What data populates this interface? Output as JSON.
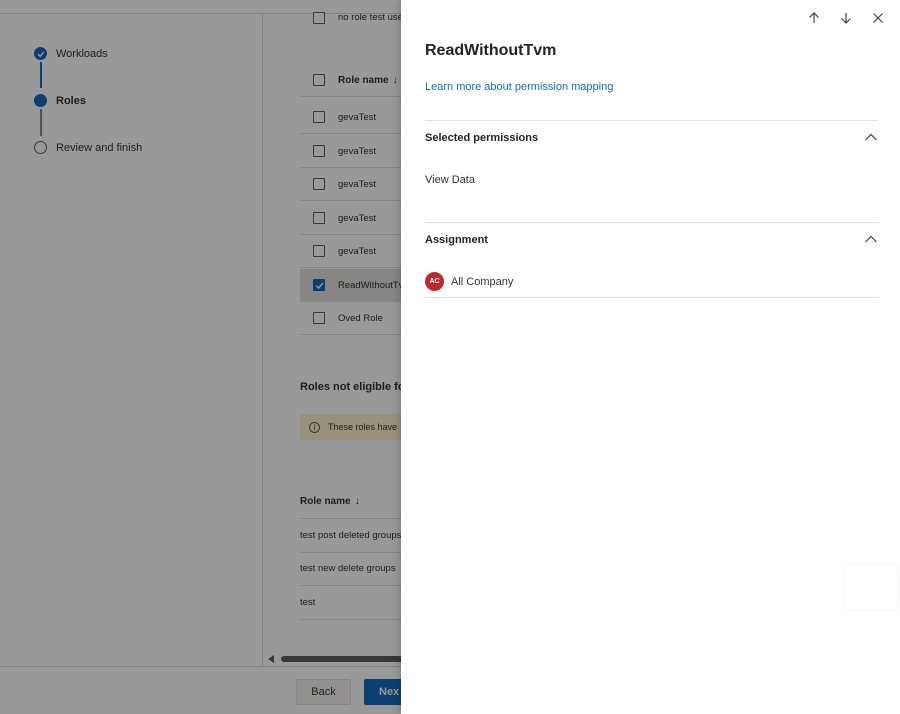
{
  "wizard": {
    "steps": [
      {
        "label": "Workloads",
        "state": "completed"
      },
      {
        "label": "Roles",
        "state": "current"
      },
      {
        "label": "Review and finish",
        "state": "pending"
      }
    ]
  },
  "roles_table": {
    "top_row": "no role test use",
    "header": "Role name",
    "sort_glyph": "↓",
    "rows": [
      {
        "name": "gevaTest",
        "checked": false
      },
      {
        "name": "gevaTest",
        "checked": false
      },
      {
        "name": "gevaTest",
        "checked": false
      },
      {
        "name": "gevaTest",
        "checked": false
      },
      {
        "name": "gevaTest",
        "checked": false
      },
      {
        "name": "ReadWithoutTv",
        "checked": true
      },
      {
        "name": "Oved Role",
        "checked": false
      }
    ]
  },
  "not_eligible": {
    "title": "Roles not eligible fo",
    "warning": "These roles have",
    "header": "Role name",
    "sort_glyph": "↓",
    "rows": [
      "test post deleted groups",
      "test new delete groups",
      "test"
    ]
  },
  "footer": {
    "back_label": "Back",
    "next_label": "Nex"
  },
  "panel": {
    "title": "ReadWithoutTvm",
    "learn_more_link": "Learn more about permission mapping",
    "icons": [
      "arrow-up-icon",
      "arrow-down-icon",
      "close-icon"
    ],
    "selected_permissions": {
      "label": "Selected permissions",
      "items": [
        "View Data"
      ]
    },
    "assignment": {
      "label": "Assignment",
      "items": [
        {
          "initials": "AC",
          "name": "All Company",
          "avatar_color": "#c0262d"
        }
      ]
    }
  },
  "colors": {
    "accent": "#0f6cbd",
    "warning_bg": "#fff4ce",
    "overlay": "rgba(0,0,0,0.40)"
  }
}
